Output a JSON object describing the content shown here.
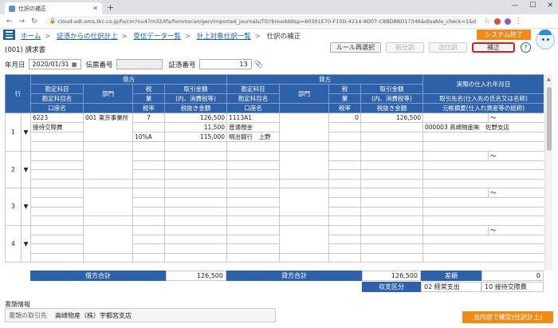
{
  "browser": {
    "tab_title": "仕訳の補正",
    "url": "cloud-adt.oms.tkc.co.jp/fx/cm?nu47m32/tfa/fxmmscan/gen/imported_journals/TD?breadddisp=60301E70-F15D-4214-9D07-C8BD8BD17346&disable_check=1&disable_cond=1..."
  },
  "breadcrumb": {
    "items": [
      "ホーム",
      "証憑からの仕訳計上",
      "受信データ一覧",
      "計上対象仕訳一覧"
    ],
    "current": "仕訳の補正"
  },
  "system_end_label": "システム終了",
  "doc_title": "(001) 請求書",
  "buttons": {
    "rule_reselect": "ルール再選択",
    "prev": "前仕訳",
    "next": "次仕訳",
    "correct": "補正"
  },
  "help_label": "?",
  "fields": {
    "date_label": "年月日",
    "date_value": "2020/01/31",
    "slip_label": "伝票番号",
    "slip_value": "",
    "voucher_label": "証憑番号",
    "voucher_value": "13"
  },
  "headers": {
    "row": "行",
    "debit": "借方",
    "credit": "貸方",
    "purchase": "実際の仕入れ年月日",
    "account": "勘定科目",
    "account_name": "勘定科目名",
    "bank": "口座名",
    "dept": "部門",
    "tax": "税",
    "tax_type": "業",
    "tax_rate": "税率",
    "amount": "取引金額",
    "amount_sub": "(内、消費税等)",
    "amount_net": "税抜き金額",
    "supplier": "取引先名(仕入先の氏名又は名称)",
    "memo": "元帳摘要(仕入れ資産等の総称)"
  },
  "rows": [
    {
      "no": "1",
      "debit_code": "6223",
      "debit_name": "接待交際費",
      "debit_dept": "001 東京事業所",
      "debit_tax": "7",
      "debit_rate": "10%A",
      "debit_amount": "126,500",
      "debit_tax_amt": "11,500",
      "debit_net": "115,000",
      "credit_code": "1113A1",
      "credit_name": "普通預金",
      "credit_bank": "明治銀行　上野",
      "credit_tax": "0",
      "credit_amount": "126,500",
      "purchase_tilde": "〜",
      "supplier": "000003 高崎物産㈱　佐野支店",
      "memo": ""
    },
    {
      "no": "2",
      "purchase_tilde": "〜"
    },
    {
      "no": "3",
      "purchase_tilde": "〜"
    },
    {
      "no": "4",
      "purchase_tilde": "〜"
    }
  ],
  "totals": {
    "debit_label": "借方合計",
    "debit_value": "126,500",
    "credit_label": "貸方合計",
    "credit_value": "126,500",
    "diff_label": "差額",
    "diff_value": "0",
    "kubun_label": "収支区分",
    "kubun_value": "02 経常支出",
    "kubun_extra": "10 接待交際費"
  },
  "info": {
    "section_title": "書類情報",
    "partner_label": "書類の取引先",
    "partner_value": "高崎物産（株）宇都宮支店"
  },
  "confirm_label": "当内容で確定(仕訳計上)"
}
